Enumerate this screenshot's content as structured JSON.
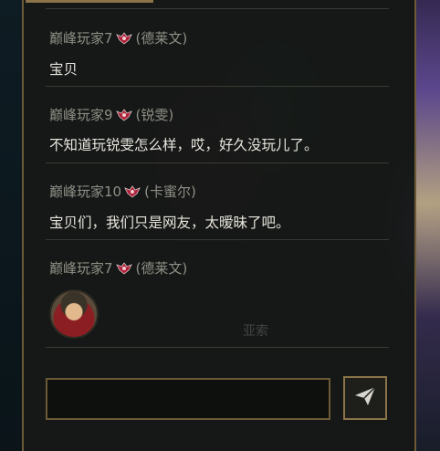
{
  "messages": [
    {
      "sender": "巅峰玩家7",
      "hero": "(德莱文)",
      "text": "宝贝"
    },
    {
      "sender": "巅峰玩家9",
      "hero": "(锐雯)",
      "text": "不知道玩锐雯怎么样，哎，好久没玩儿了。"
    },
    {
      "sender": "巅峰玩家10",
      "hero": "(卡蜜尔)",
      "text": "宝贝们，我们只是网友，太暧昧了吧。"
    },
    {
      "sender": "巅峰玩家7",
      "hero": "(德莱文)",
      "text": ""
    }
  ],
  "background_label": "亚索",
  "input": {
    "value": "",
    "placeholder": ""
  },
  "icons": {
    "rank": "rank-badge-icon",
    "send": "send-icon"
  },
  "colors": {
    "border": "#6b5a35",
    "text": "#e6e4dc",
    "sender": "#8f8f86",
    "rank": "#b0203a"
  }
}
